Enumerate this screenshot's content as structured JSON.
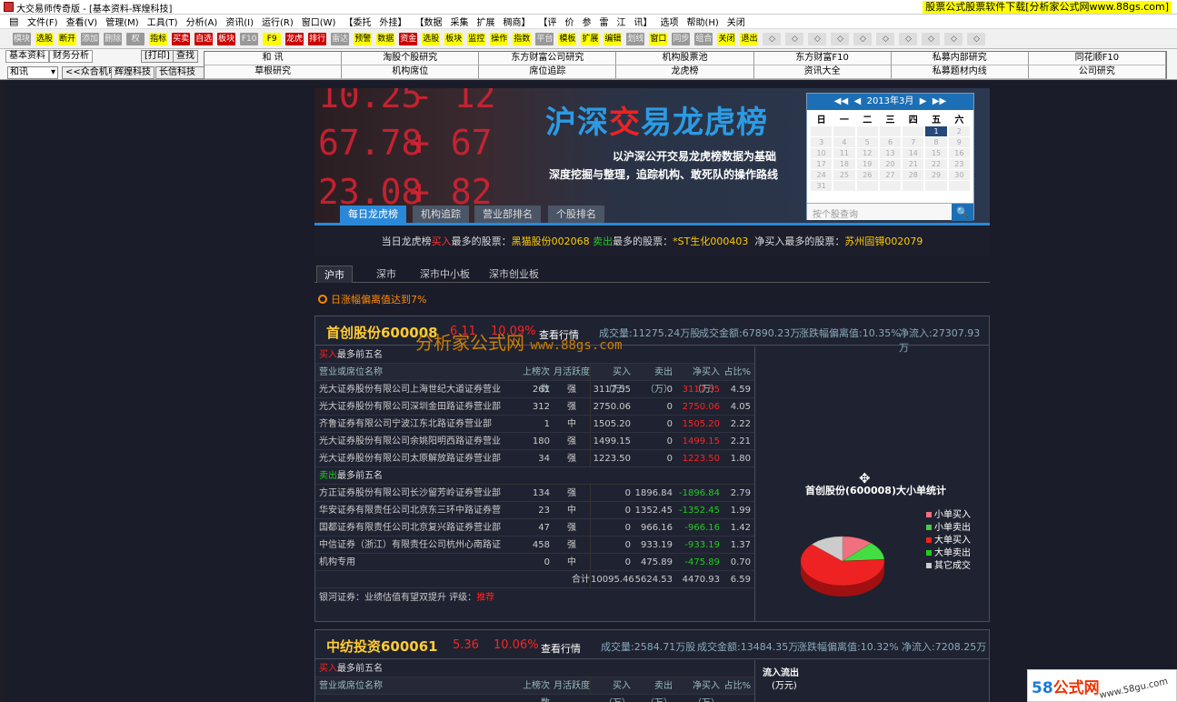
{
  "window": {
    "title": "大交易师传奇版 - [基本资料-辉煌科技]",
    "ad_text": "股票公式股票软件下载[分析家公式网www.88gs.com]"
  },
  "menu": [
    "文件(F)",
    "查看(V)",
    "管理(M)",
    "工具(T)",
    "分析(A)",
    "资讯(I)",
    "运行(R)",
    "窗口(W)",
    "【委托",
    "外挂】",
    "【数据",
    "采集",
    "扩展",
    "稠商】",
    "【评",
    "价",
    "参",
    "雷",
    "江",
    "讯】",
    "选项",
    "帮助(H)",
    "关闭"
  ],
  "toolbar": [
    {
      "label": "模块",
      "style": "g"
    },
    {
      "label": "选股",
      "style": "y"
    },
    {
      "label": "断开",
      "style": "y"
    },
    {
      "label": "添加",
      "style": "g"
    },
    {
      "label": "删除",
      "style": "g"
    },
    {
      "label": "权",
      "style": "g"
    },
    {
      "label": "指标",
      "style": "y"
    },
    {
      "label": "买卖",
      "style": "r"
    },
    {
      "label": "自选",
      "style": "r"
    },
    {
      "label": "板块",
      "style": "r"
    },
    {
      "label": "F10",
      "style": "g"
    },
    {
      "label": "F9",
      "style": "y"
    },
    {
      "label": "龙虎",
      "style": "r"
    },
    {
      "label": "排行",
      "style": "r"
    },
    {
      "label": "雷达",
      "style": "g"
    },
    {
      "label": "预警",
      "style": "y"
    },
    {
      "label": "数据",
      "style": "y"
    },
    {
      "label": "资金",
      "style": "r"
    },
    {
      "label": "选股",
      "style": "y"
    },
    {
      "label": "板块",
      "style": "y"
    },
    {
      "label": "监控",
      "style": "y"
    },
    {
      "label": "操作",
      "style": "y"
    },
    {
      "label": "指数",
      "style": "y"
    },
    {
      "label": "平台",
      "style": "g"
    },
    {
      "label": "模板",
      "style": "y"
    },
    {
      "label": "扩展",
      "style": "y"
    },
    {
      "label": "编辑",
      "style": "y"
    },
    {
      "label": "划线",
      "style": "g"
    },
    {
      "label": "窗口",
      "style": "y"
    },
    {
      "label": "同步",
      "style": "g"
    },
    {
      "label": "组合",
      "style": "g"
    },
    {
      "label": "关闭",
      "style": "y"
    },
    {
      "label": "退出",
      "style": "y"
    }
  ],
  "nav": {
    "tab1": "基本资料",
    "tab2": "财务分析",
    "print": "[打印]",
    "search": "查找",
    "select": "和讯",
    "links": [
      "<<众合机电",
      "辉煌科技",
      "长信科技>>"
    ],
    "grid": [
      [
        "和    讯",
        "淘股个股研究",
        "东方财富公司研究",
        "机构股票池",
        "东方财富F10",
        "私募内部研究",
        "同花顺F10"
      ],
      [
        "草根研究",
        "机构席位",
        "席位追踪",
        "龙虎榜",
        "资讯大全",
        "私募题材内线",
        "公司研究"
      ]
    ]
  },
  "banner": {
    "tickers": [
      "10.25",
      "- 12",
      "67.78",
      "+ 67",
      "23.08",
      "+ 82"
    ],
    "title_a": "沪深",
    "title_b": "交",
    "title_c": "易龙虎榜",
    "sub1": "以沪深公开交易龙虎榜数据为基础",
    "sub2": "深度挖掘与整理，追踪机构、敢死队的操作路线",
    "calendar": {
      "month": "2013年3月",
      "weekdays": [
        "日",
        "一",
        "二",
        "三",
        "四",
        "五",
        "六"
      ],
      "days": [
        "",
        "",
        "",
        "",
        "",
        "1",
        "2",
        "3",
        "4",
        "5",
        "6",
        "7",
        "8",
        "9",
        "10",
        "11",
        "12",
        "13",
        "14",
        "15",
        "16",
        "17",
        "18",
        "19",
        "20",
        "21",
        "22",
        "23",
        "24",
        "25",
        "26",
        "27",
        "28",
        "29",
        "30",
        "31",
        "",
        "",
        "",
        "",
        "",
        ""
      ],
      "selected": "1",
      "search_placeholder": "按个股查询"
    },
    "tabs": [
      "每日龙虎榜",
      "机构追踪",
      "营业部排名",
      "个股排名"
    ]
  },
  "summary": {
    "p1": "当日龙虎榜",
    "buy": "买入",
    "p2": "最多的股票：",
    "s1": "黑猫股份002068",
    "sell": "卖出",
    "p3": "最多的股票：",
    "s2": "*ST生化000403",
    "p4": "净买入最多的股票：",
    "s3": "苏州固锝002079"
  },
  "market_tabs": [
    "沪市",
    "深市",
    "深市中小板",
    "深市创业板"
  ],
  "condition": "日涨幅偏离值达到7%",
  "watermark": {
    "cn": "分析家公式网",
    "url": "www.88gs.com"
  },
  "columns": [
    "营业或席位名称",
    "上榜次数",
    "月活跃度",
    "买入（万）",
    "卖出（万）",
    "净买入（万）",
    "占比%"
  ],
  "card1": {
    "name": "首创股份600008",
    "price": "6.11",
    "change": "10.09%",
    "quote_link": "查看行情",
    "volume": "成交量:11275.24万股",
    "amount": "成交金额:67890.23万",
    "deviation": "涨跌幅偏离值:10.35%",
    "net_inflow": "净流入:27307.93万",
    "buy_label_r": "买入",
    "buy_label": "最多前五名",
    "buys": [
      [
        "光大证券股份有限公司上海世纪大道证券营业",
        "261",
        "强",
        "3117.55",
        "0",
        "3117.55",
        "4.59"
      ],
      [
        "光大证券股份有限公司深圳金田路证券营业部",
        "312",
        "强",
        "2750.06",
        "0",
        "2750.06",
        "4.05"
      ],
      [
        "齐鲁证券有限公司宁波江东北路证券营业部",
        "1",
        "中",
        "1505.20",
        "0",
        "1505.20",
        "2.22"
      ],
      [
        "光大证券股份有限公司余姚阳明西路证券营业",
        "180",
        "强",
        "1499.15",
        "0",
        "1499.15",
        "2.21"
      ],
      [
        "光大证券股份有限公司太原解放路证券营业部",
        "34",
        "强",
        "1223.50",
        "0",
        "1223.50",
        "1.80"
      ]
    ],
    "sell_label_g": "卖出",
    "sell_label": "最多前五名",
    "sells": [
      [
        "方正证券股份有限公司长沙留芳岭证券营业部",
        "134",
        "强",
        "0",
        "1896.84",
        "-1896.84",
        "2.79"
      ],
      [
        "华安证券有限责任公司北京东三环中路证券营",
        "23",
        "中",
        "0",
        "1352.45",
        "-1352.45",
        "1.99"
      ],
      [
        "国都证券有限责任公司北京复兴路证券营业部",
        "47",
        "强",
        "0",
        "966.16",
        "-966.16",
        "1.42"
      ],
      [
        "中信证券（浙江）有限责任公司杭州心南路证",
        "458",
        "强",
        "0",
        "933.19",
        "-933.19",
        "1.37"
      ],
      [
        "机构专用",
        "0",
        "中",
        "0",
        "475.89",
        "-475.89",
        "0.70"
      ]
    ],
    "total": [
      "合计",
      "10095.46",
      "5624.53",
      "4470.93",
      "6.59"
    ],
    "rating_text": "银河证券：业绩估值有望双提升  评级：",
    "rating": "推荐",
    "pie_title": "首创股份(600008)大小单统计",
    "legend": [
      "小单买入",
      "小单卖出",
      "大单买入",
      "大单卖出",
      "其它成交"
    ]
  },
  "card2": {
    "name": "中纺投资600061",
    "price": "5.36",
    "change": "10.06%",
    "quote_link": "查看行情",
    "volume": "成交量:2584.71万股",
    "amount": "成交金额:13484.35万",
    "deviation": "涨跌幅偏离值:10.32%",
    "net_inflow": "净流入:7208.25万",
    "buy_label_r": "买入",
    "buy_label": "最多前五名",
    "flow_title": "流入流出",
    "flow_unit": "(万元)"
  },
  "site_logo": {
    "a": "58",
    "b": "公式网",
    "url": "www.58gu.com"
  },
  "colors": {
    "accent": "#2a88d8",
    "up": "#ff2222",
    "down": "#22cc22",
    "gold": "#ffcc33"
  },
  "chart_data": {
    "type": "pie",
    "title": "首创股份(600008)大小单统计",
    "series": [
      {
        "values": [
          12,
          12,
          63,
          0,
          13
        ]
      }
    ],
    "categories": [
      "小单买入",
      "小单卖出",
      "大单买入",
      "大单卖出",
      "其它成交"
    ]
  }
}
